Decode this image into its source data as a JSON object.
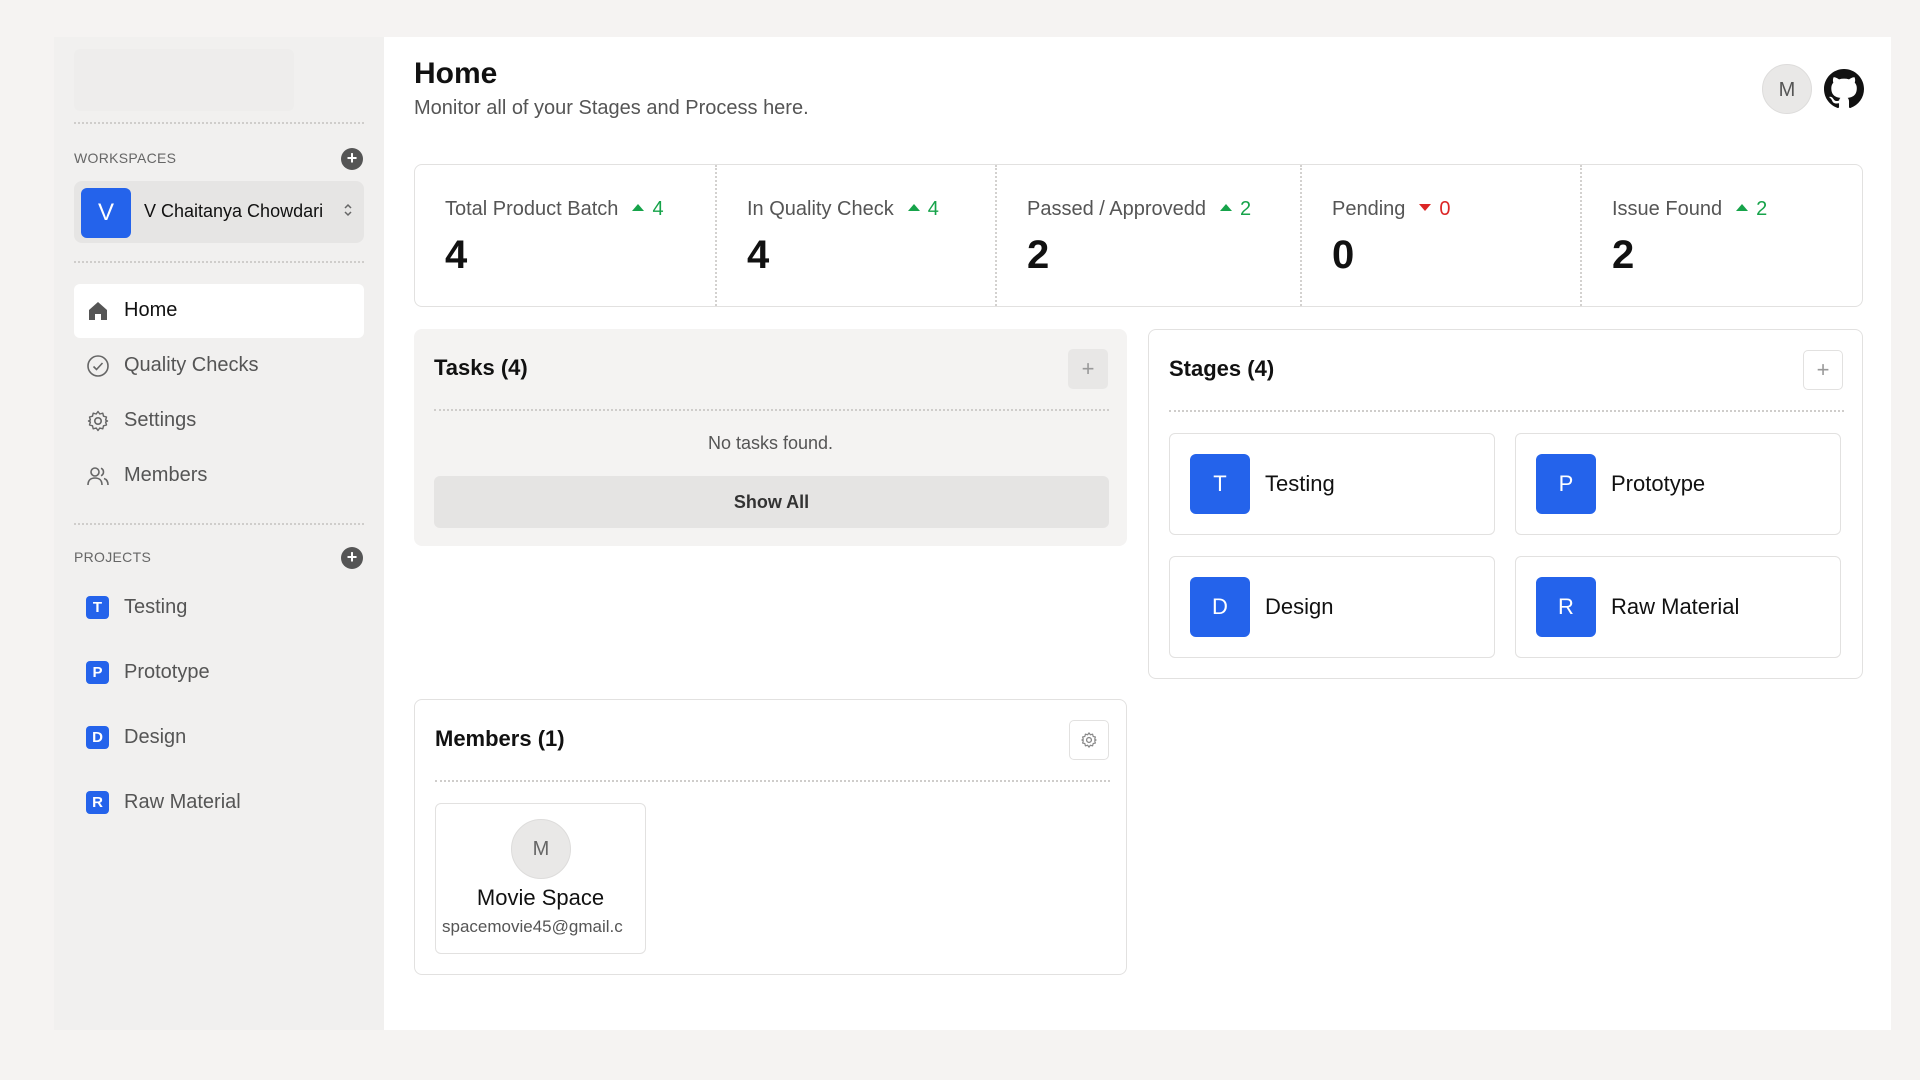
{
  "sidebar": {
    "workspaces_heading": "WORKSPACES",
    "workspace": {
      "initial": "V",
      "name": "V Chaitanya Chowdari"
    },
    "nav": [
      {
        "label": "Home",
        "icon": "home-icon"
      },
      {
        "label": "Quality Checks",
        "icon": "check-circle-icon"
      },
      {
        "label": "Settings",
        "icon": "gear-icon"
      },
      {
        "label": "Members",
        "icon": "users-icon"
      }
    ],
    "projects_heading": "PROJECTS",
    "projects": [
      {
        "initial": "T",
        "label": "Testing"
      },
      {
        "initial": "P",
        "label": "Prototype"
      },
      {
        "initial": "D",
        "label": "Design"
      },
      {
        "initial": "R",
        "label": "Raw Material"
      }
    ]
  },
  "header": {
    "title": "Home",
    "subtitle": "Monitor all of your Stages and Process here.",
    "avatar_initial": "M"
  },
  "stats": [
    {
      "label": "Total Product Batch",
      "value": "4",
      "change": "4",
      "direction": "up"
    },
    {
      "label": "In Quality Check",
      "value": "4",
      "change": "4",
      "direction": "up"
    },
    {
      "label": "Passed / Approvedd",
      "value": "2",
      "change": "2",
      "direction": "up"
    },
    {
      "label": "Pending",
      "value": "0",
      "change": "0",
      "direction": "down"
    },
    {
      "label": "Issue Found",
      "value": "2",
      "change": "2",
      "direction": "up"
    }
  ],
  "tasks": {
    "title": "Tasks (4)",
    "empty": "No tasks found.",
    "show_all": "Show All"
  },
  "stages": {
    "title": "Stages (4)",
    "items": [
      {
        "initial": "T",
        "label": "Testing"
      },
      {
        "initial": "P",
        "label": "Prototype"
      },
      {
        "initial": "D",
        "label": "Design"
      },
      {
        "initial": "R",
        "label": "Raw Material"
      }
    ]
  },
  "members": {
    "title": "Members (1)",
    "items": [
      {
        "initial": "M",
        "name": "Movie Space",
        "email": "spacemovie45@gmail.c"
      }
    ]
  },
  "colors": {
    "accent": "#2463eb",
    "up": "#16a34a",
    "down": "#dc2626",
    "background": "#f5f3f2"
  }
}
